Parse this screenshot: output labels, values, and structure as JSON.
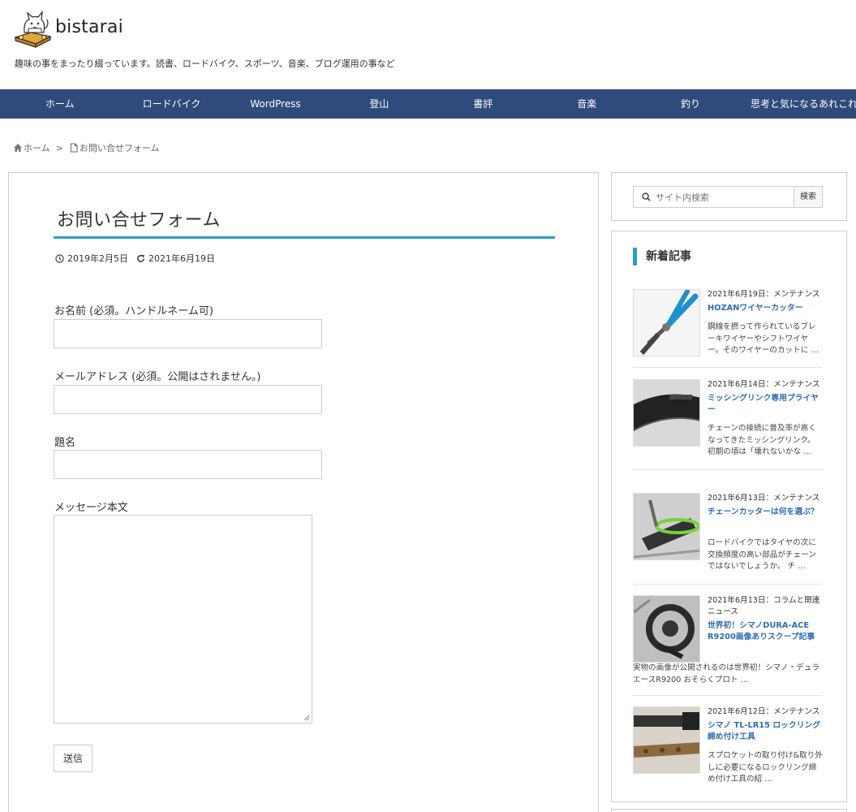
{
  "site": {
    "title": "bistarai",
    "description": "趣味の事をまったり綴っています。読書、ロードバイク、スポーツ、音楽、ブログ運用の事など"
  },
  "nav": {
    "items": [
      {
        "label": "ホーム"
      },
      {
        "label": "ロードバイク"
      },
      {
        "label": "WordPress"
      },
      {
        "label": "登山"
      },
      {
        "label": "書評"
      },
      {
        "label": "音楽"
      },
      {
        "label": "釣り"
      },
      {
        "label": "思考と気になるあれこれ"
      }
    ]
  },
  "breadcrumb": {
    "home": "ホーム",
    "separator": ">",
    "current": "お問い合せフォーム"
  },
  "page": {
    "title": "お問い合せフォーム",
    "published": "2019年2月5日",
    "updated": "2021年6月19日"
  },
  "form": {
    "name_label": "お名前 (必須。ハンドルネーム可)",
    "email_label": "メールアドレス (必須。公開はされません。)",
    "subject_label": "題名",
    "message_label": "メッセージ本文",
    "submit_label": "送信"
  },
  "sidebar": {
    "search_placeholder": "サイト内検索",
    "search_button": "検索",
    "recent_heading": "新着記事",
    "posts": [
      {
        "date": "2021年6月19日：メンテナンス",
        "title": "HOZANワイヤーカッター",
        "excerpt": "鋼線を撚って作られているブレーキワイヤーやシフトワイヤー。そのワイヤーのカットに …"
      },
      {
        "date": "2021年6月14日：メンテナンス",
        "title": "ミッシングリンク専用プライヤー",
        "excerpt": "チェーンの接続に普及率が高くなってきたミッシングリンク。初期の頃は「壊れないかな …"
      },
      {
        "date": "2021年6月13日：メンテナンス",
        "title": "チェーンカッターは何を選ぶ？",
        "excerpt": "ロードバイクではタイヤの次に交換頻度の高い部品がチェーンではないでしょうか。 チ …"
      },
      {
        "date": "2021年6月13日：コラムと関連ニュース",
        "title": "世界初！シマノDURA-ACE R9200画像ありスクープ記事",
        "excerpt": "実物の画像が公開されるのは世界初！シマノ・デュラエースR9200 おそらくプロト …"
      },
      {
        "date": "2021年6月12日：メンテナンス",
        "title": "シマノ TL-LR15 ロックリング締め付け工具",
        "excerpt": "スプロケットの取り付け&取り外しに必要になるロックリング締め付け工具の紹 …"
      }
    ]
  },
  "colors": {
    "nav_bg": "#2f4a7c",
    "accent": "#2a9ec6",
    "link": "#2e6db4"
  }
}
